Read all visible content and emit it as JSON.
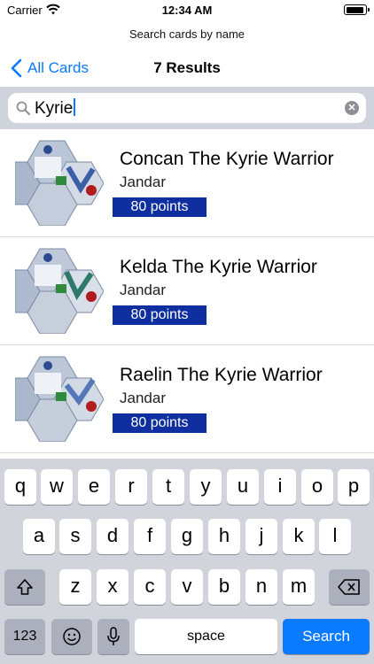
{
  "status_bar": {
    "carrier": "Carrier",
    "time": "12:34 AM"
  },
  "header": {
    "prompt": "Search cards by name",
    "back_label": "All Cards",
    "title": "7 Results"
  },
  "search": {
    "value": "Kyrie"
  },
  "results": [
    {
      "name": "Concan The Kyrie Warrior",
      "faction": "Jandar",
      "points": "80 points"
    },
    {
      "name": "Kelda The Kyrie Warrior",
      "faction": "Jandar",
      "points": "80 points"
    },
    {
      "name": "Raelin The Kyrie Warrior",
      "faction": "Jandar",
      "points": "80 points"
    }
  ],
  "keyboard": {
    "row1": [
      "q",
      "w",
      "e",
      "r",
      "t",
      "y",
      "u",
      "i",
      "o",
      "p"
    ],
    "row2": [
      "a",
      "s",
      "d",
      "f",
      "g",
      "h",
      "j",
      "k",
      "l"
    ],
    "row3": [
      "z",
      "x",
      "c",
      "v",
      "b",
      "n",
      "m"
    ],
    "numbers_label": "123",
    "space_label": "space",
    "search_label": "Search"
  },
  "colors": {
    "accent": "#0a7aff",
    "points_badge": "#0f2fa1",
    "search_bar_bg": "#cfd3db"
  }
}
